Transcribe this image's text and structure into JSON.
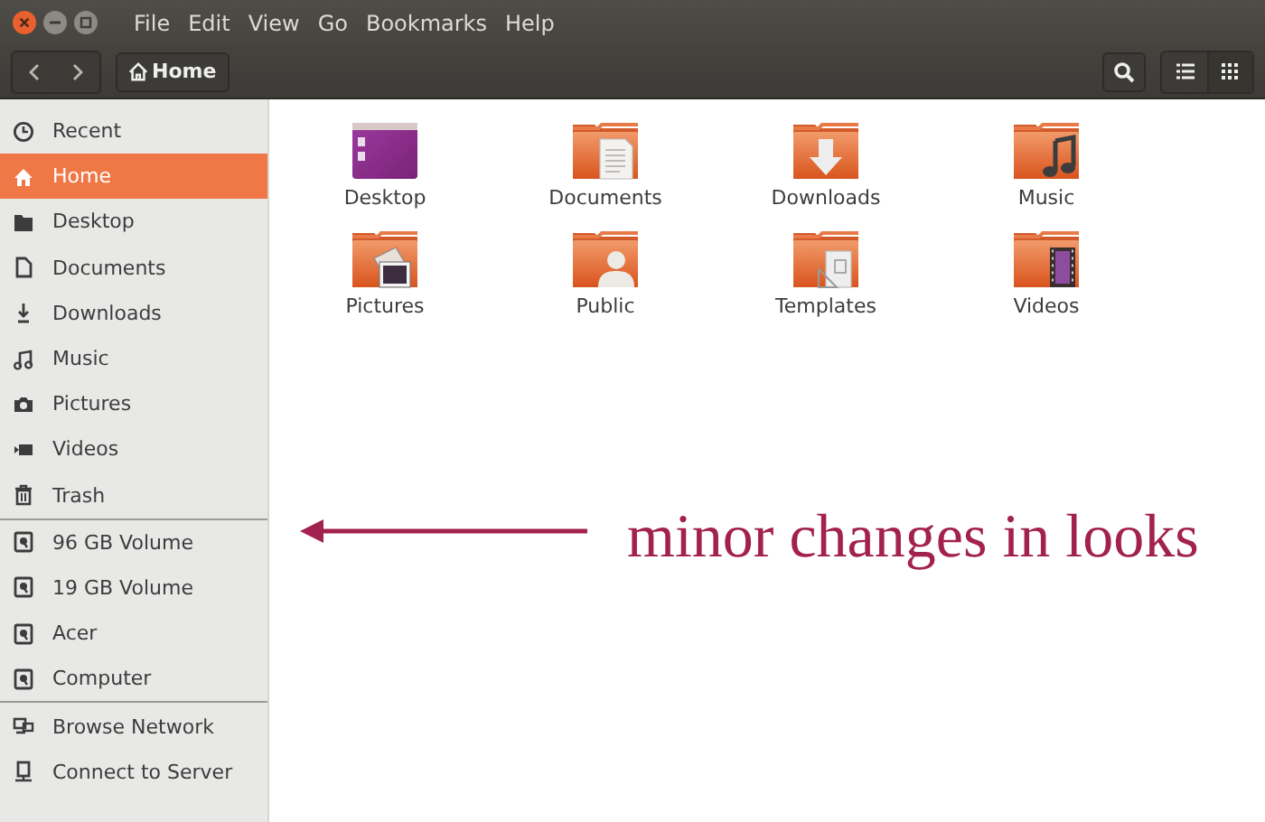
{
  "window": {
    "menu": [
      "File",
      "Edit",
      "View",
      "Go",
      "Bookmarks",
      "Help"
    ]
  },
  "toolbar": {
    "path_button": "Home"
  },
  "sidebar": {
    "sections": [
      {
        "items": [
          {
            "label": "Recent",
            "kind": "clock",
            "selected": false
          },
          {
            "label": "Home",
            "kind": "home",
            "selected": true
          },
          {
            "label": "Desktop",
            "kind": "folder",
            "selected": false
          },
          {
            "label": "Documents",
            "kind": "document",
            "selected": false
          },
          {
            "label": "Downloads",
            "kind": "download",
            "selected": false
          },
          {
            "label": "Music",
            "kind": "music",
            "selected": false
          },
          {
            "label": "Pictures",
            "kind": "camera",
            "selected": false
          },
          {
            "label": "Videos",
            "kind": "video",
            "selected": false
          },
          {
            "label": "Trash",
            "kind": "trash",
            "selected": false
          }
        ]
      },
      {
        "items": [
          {
            "label": "96 GB Volume",
            "kind": "drive",
            "selected": false
          },
          {
            "label": "19 GB Volume",
            "kind": "drive",
            "selected": false
          },
          {
            "label": "Acer",
            "kind": "drive",
            "selected": false
          },
          {
            "label": "Computer",
            "kind": "drive",
            "selected": false
          }
        ]
      },
      {
        "items": [
          {
            "label": "Browse Network",
            "kind": "network",
            "selected": false
          },
          {
            "label": "Connect to Server",
            "kind": "server",
            "selected": false
          }
        ]
      }
    ]
  },
  "files": [
    {
      "name": "Desktop",
      "kind": "desktop"
    },
    {
      "name": "Documents",
      "kind": "documents"
    },
    {
      "name": "Downloads",
      "kind": "downloads"
    },
    {
      "name": "Music",
      "kind": "music"
    },
    {
      "name": "Pictures",
      "kind": "pictures"
    },
    {
      "name": "Public",
      "kind": "public"
    },
    {
      "name": "Templates",
      "kind": "templates"
    },
    {
      "name": "Videos",
      "kind": "videos"
    }
  ],
  "annotation": {
    "text": "minor changes in looks"
  }
}
